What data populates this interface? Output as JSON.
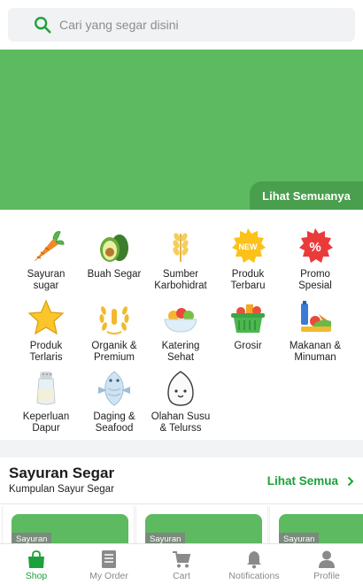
{
  "search": {
    "placeholder": "Cari yang segar disini"
  },
  "banner": {
    "see_all": "Lihat Semuanya"
  },
  "categories": [
    {
      "label": "Sayuran\nsugar",
      "icon": "carrot-icon"
    },
    {
      "label": "Buah Segar",
      "icon": "avocado-icon"
    },
    {
      "label": "Sumber\nKarbohidrat",
      "icon": "wheat-icon"
    },
    {
      "label": "Produk\nTerbaru",
      "icon": "new-badge-icon"
    },
    {
      "label": "Promo\nSpesial",
      "icon": "percent-badge-icon"
    },
    {
      "label": "Produk\nTerlaris",
      "icon": "star-icon"
    },
    {
      "label": "Organik &\nPremium",
      "icon": "laurel-icon"
    },
    {
      "label": "Katering\nSehat",
      "icon": "fruit-bowl-icon"
    },
    {
      "label": "Grosir",
      "icon": "basket-icon"
    },
    {
      "label": "Makanan &\nMinuman",
      "icon": "groceries-icon"
    },
    {
      "label": "Keperluan\nDapur",
      "icon": "salt-shaker-icon"
    },
    {
      "label": "Daging &\nSeafood",
      "icon": "fish-icon"
    },
    {
      "label": "Olahan Susu\n& Telurss",
      "icon": "egg-icon"
    }
  ],
  "section": {
    "title": "Sayuran Segar",
    "subtitle": "Kumpulan Sayur Segar",
    "see_all": "Lihat Semua",
    "cards": [
      {
        "tag": "Sayuran"
      },
      {
        "tag": "Sayuran"
      },
      {
        "tag": "Sayuran"
      }
    ]
  },
  "nav": [
    {
      "label": "Shop",
      "icon": "shop-bag-icon",
      "active": true
    },
    {
      "label": "My Order",
      "icon": "order-list-icon",
      "active": false
    },
    {
      "label": "Cart",
      "icon": "cart-icon",
      "active": false
    },
    {
      "label": "Notifications",
      "icon": "bell-icon",
      "active": false
    },
    {
      "label": "Profile",
      "icon": "person-icon",
      "active": false
    }
  ],
  "colors": {
    "accent": "#1ba23a",
    "banner": "#5dba61",
    "banner_dark": "#4a9f4e"
  }
}
